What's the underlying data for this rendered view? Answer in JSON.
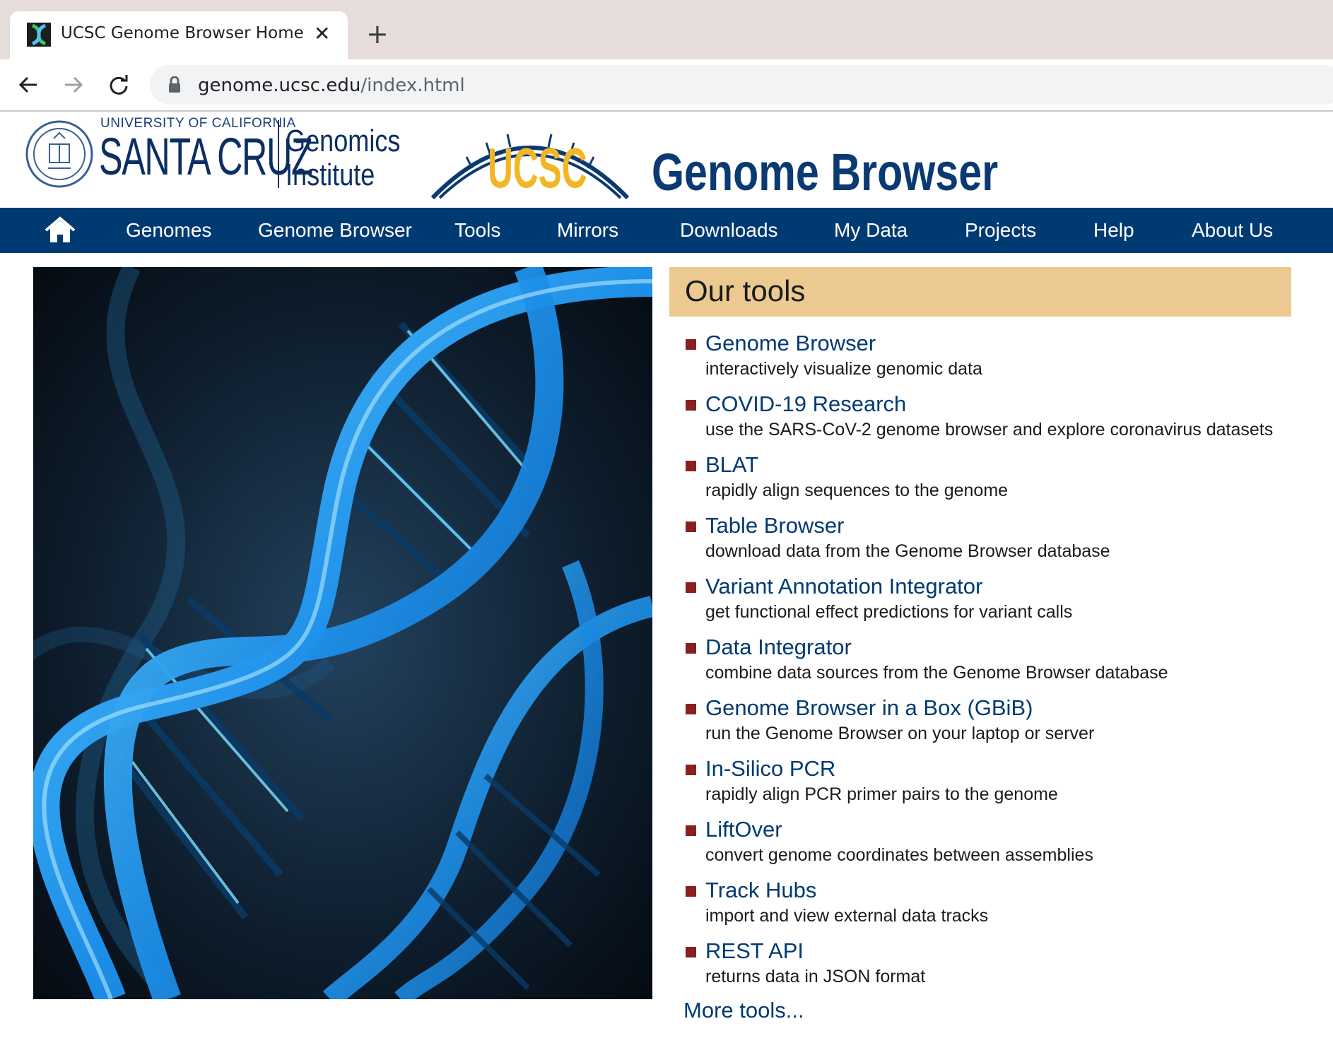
{
  "browser": {
    "tab_title": "UCSC Genome Browser Home",
    "url_domain": "genome.ucsc.edu",
    "url_path": "/index.html"
  },
  "header": {
    "university_line": "UNIVERSITY OF CALIFORNIA",
    "santa_cruz": "SANTA CRUZ",
    "genomics": "Genomics",
    "institute": "Institute",
    "ucsc_logo": "UCSC",
    "site_title": "Genome Browser"
  },
  "nav": {
    "items": [
      {
        "label": "Genomes"
      },
      {
        "label": "Genome Browser"
      },
      {
        "label": "Tools"
      },
      {
        "label": "Mirrors"
      },
      {
        "label": "Downloads"
      },
      {
        "label": "My Data"
      },
      {
        "label": "Projects"
      },
      {
        "label": "Help"
      },
      {
        "label": "About Us"
      }
    ]
  },
  "tools": {
    "heading": "Our tools",
    "items": [
      {
        "name": "Genome Browser",
        "desc": "interactively visualize genomic data"
      },
      {
        "name": "COVID-19 Research",
        "desc": "use the SARS-CoV-2 genome browser and explore coronavirus datasets"
      },
      {
        "name": "BLAT",
        "desc": "rapidly align sequences to the genome"
      },
      {
        "name": "Table Browser",
        "desc": "download data from the Genome Browser database"
      },
      {
        "name": "Variant Annotation Integrator",
        "desc": "get functional effect predictions for variant calls"
      },
      {
        "name": "Data Integrator",
        "desc": "combine data sources from the Genome Browser database"
      },
      {
        "name": "Genome Browser in a Box (GBiB)",
        "desc": "run the Genome Browser on your laptop or server"
      },
      {
        "name": "In-Silico PCR",
        "desc": "rapidly align PCR primer pairs to the genome"
      },
      {
        "name": "LiftOver",
        "desc": "convert genome coordinates between assemblies"
      },
      {
        "name": "Track Hubs",
        "desc": "import and view external data tracks"
      },
      {
        "name": "REST API",
        "desc": "returns data in JSON format"
      }
    ],
    "more_label": "More tools..."
  },
  "colors": {
    "nav_bg": "#003a72",
    "tools_header_bg": "#ebc991",
    "bullet": "#8a1f1f",
    "link": "#003a72",
    "logo_gold": "#f2b625"
  },
  "icons": {
    "favicon": "dna-favicon-icon",
    "close": "close-icon",
    "new_tab": "plus-icon",
    "back": "arrow-left-icon",
    "forward": "arrow-right-icon",
    "reload": "reload-icon",
    "lock": "lock-icon",
    "home": "home-icon",
    "seal": "university-seal-icon"
  }
}
